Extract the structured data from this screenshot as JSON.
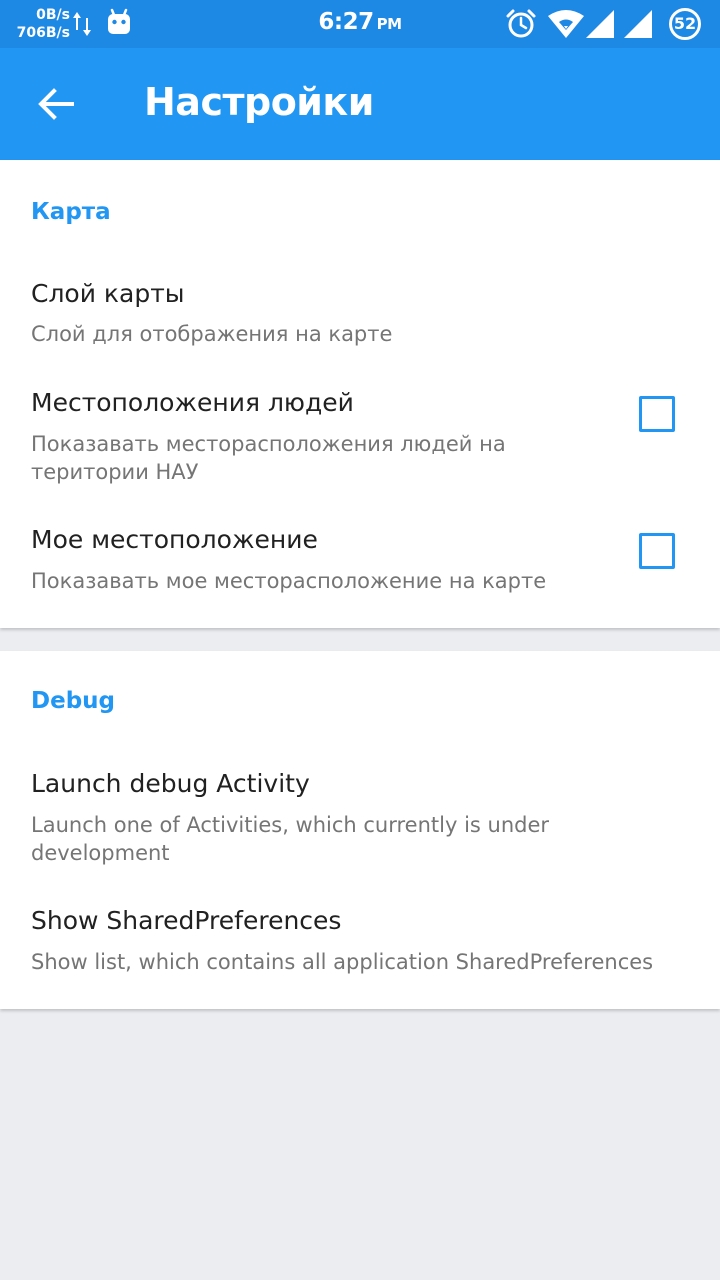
{
  "status_bar": {
    "upload_speed": "0B/s",
    "download_speed": "706B/s",
    "time": "6:27",
    "ampm": "PM",
    "battery": "52"
  },
  "app_bar": {
    "title": "Настройки",
    "back_icon": "arrow-back-icon"
  },
  "sections": [
    {
      "header": "Карта",
      "items": [
        {
          "title": "Слой карты",
          "summary": "Слой для отображения на карте"
        },
        {
          "title": "Местоположения людей",
          "summary": "Показавать месторасположения людей на територии НАУ",
          "checked": false
        },
        {
          "title": "Мое местоположение",
          "summary": "Показавать мое месторасположение на карте",
          "checked": false
        }
      ]
    },
    {
      "header": "Debug",
      "items": [
        {
          "title": "Launch debug Activity",
          "summary": "Launch one of Activities, which currently is under development"
        },
        {
          "title": "Show SharedPreferences",
          "summary": "Show list, which contains all application SharedPreferences"
        }
      ]
    }
  ],
  "colors": {
    "status_bar": "#1e88e5",
    "app_bar": "#2196f3",
    "accent": "#2196f3",
    "background": "#ebedf1"
  }
}
